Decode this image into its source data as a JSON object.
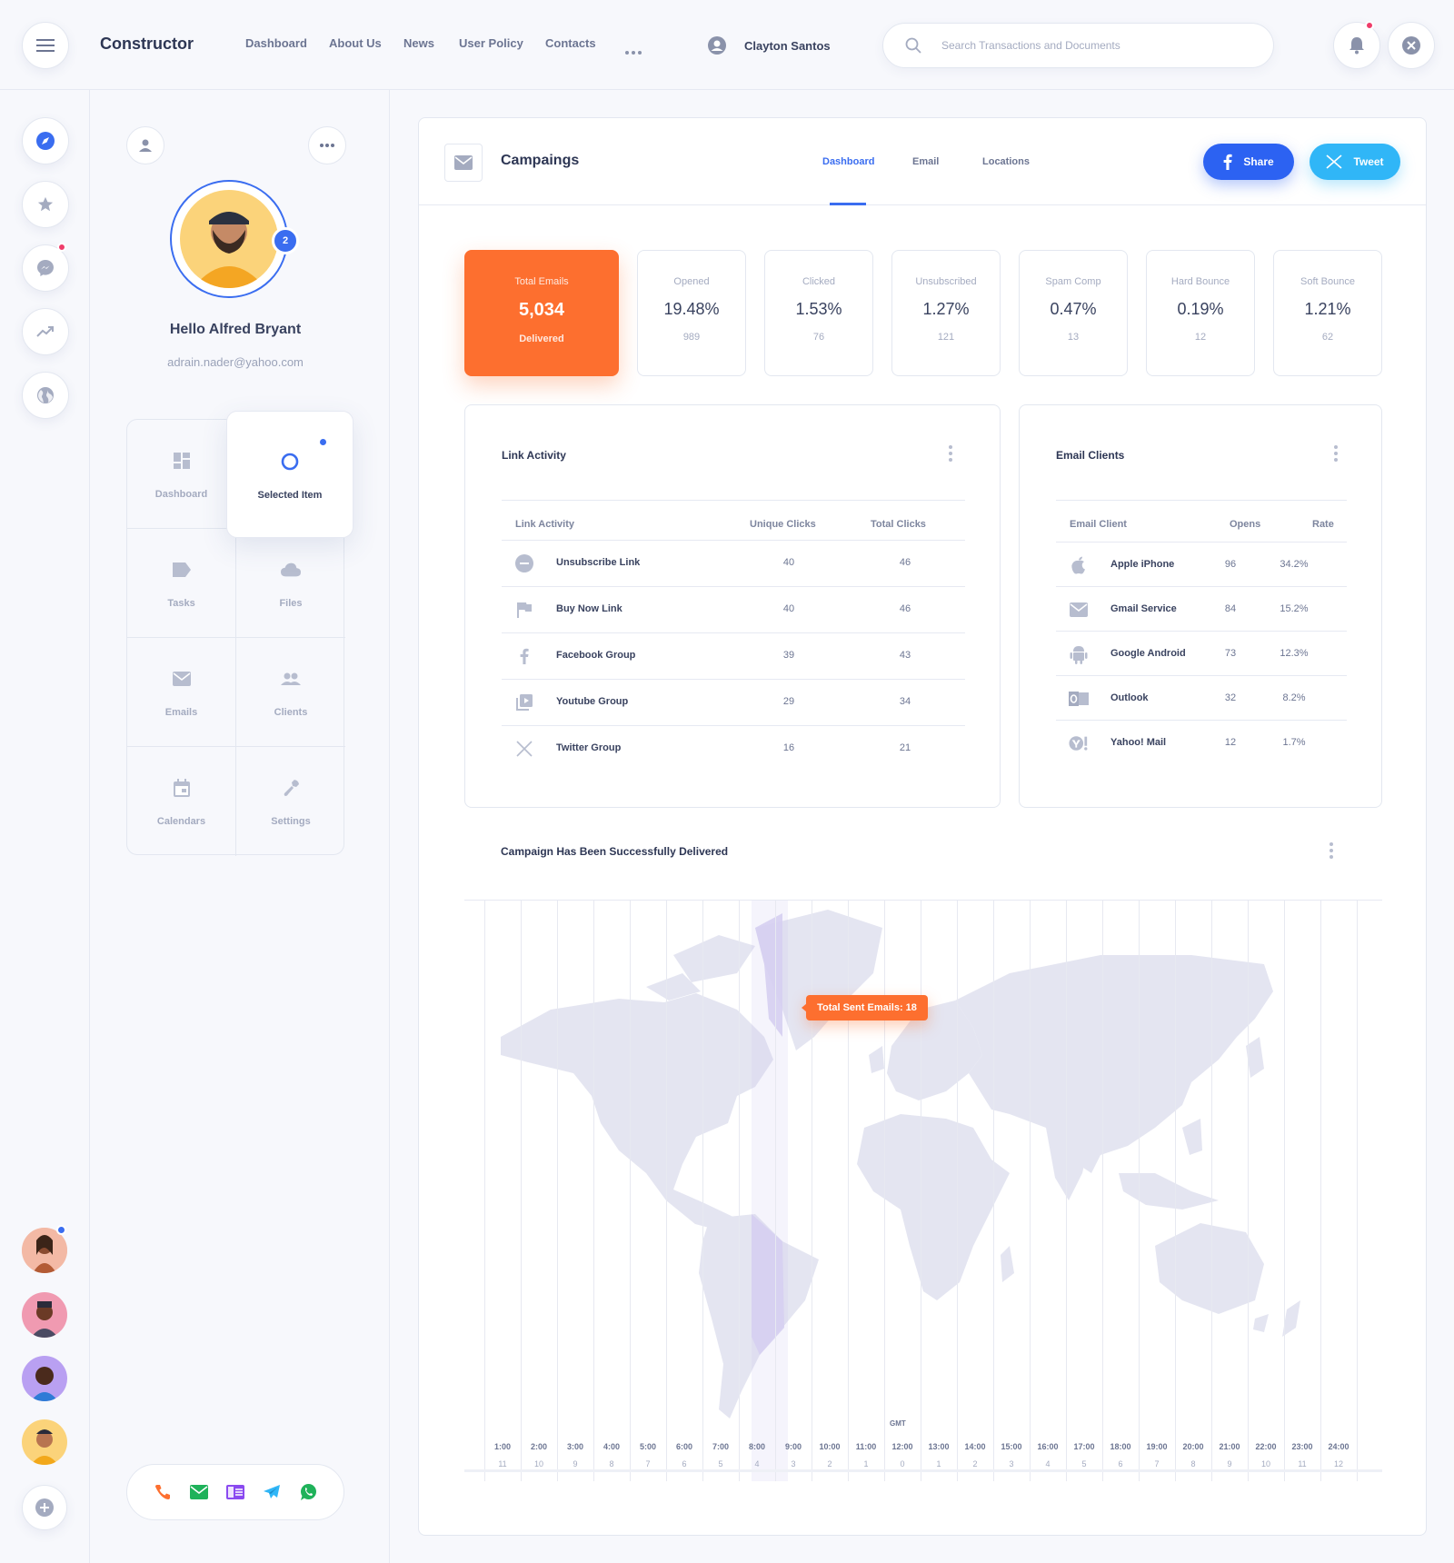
{
  "app": {
    "brand": "Constructor",
    "nav": [
      "Dashboard",
      "About Us",
      "News",
      "User Policy",
      "Contacts"
    ],
    "user_name": "Clayton Santos",
    "search_placeholder": "Search Transactions and Documents"
  },
  "profile": {
    "badge": "2",
    "greeting": "Hello Alfred Bryant",
    "email": "adrain.nader@yahoo.com",
    "menu": [
      {
        "label": "Dashboard",
        "icon": "dashboard-icon"
      },
      {
        "label": "Selected Item",
        "icon": "circle-icon"
      },
      {
        "label": "Tasks",
        "icon": "label-icon"
      },
      {
        "label": "Files",
        "icon": "cloud-icon"
      },
      {
        "label": "Emails",
        "icon": "mail-icon"
      },
      {
        "label": "Clients",
        "icon": "people-icon"
      },
      {
        "label": "Calendars",
        "icon": "calendar-icon"
      },
      {
        "label": "Settings",
        "icon": "wrench-icon"
      }
    ]
  },
  "campaign": {
    "title": "Campaings",
    "tabs": [
      "Dashboard",
      "Email",
      "Locations"
    ],
    "share_label": "Share",
    "tweet_label": "Tweet",
    "stats": [
      {
        "title": "Total Emails",
        "value": "5,034",
        "sub": "Delivered"
      },
      {
        "title": "Opened",
        "value": "19.48%",
        "sub": "989"
      },
      {
        "title": "Clicked",
        "value": "1.53%",
        "sub": "76"
      },
      {
        "title": "Unsubscribed",
        "value": "1.27%",
        "sub": "121"
      },
      {
        "title": "Spam Comp",
        "value": "0.47%",
        "sub": "13"
      },
      {
        "title": "Hard Bounce",
        "value": "0.19%",
        "sub": "12"
      },
      {
        "title": "Soft Bounce",
        "value": "1.21%",
        "sub": "62"
      }
    ]
  },
  "link_activity": {
    "title": "Link Activity",
    "headers": [
      "Link Activity",
      "Unique Clicks",
      "Total Clicks"
    ],
    "rows": [
      {
        "name": "Unsubscribe Link",
        "unique": "40",
        "total": "46",
        "icon": "minus-circle-icon"
      },
      {
        "name": "Buy Now Link",
        "unique": "40",
        "total": "46",
        "icon": "flag-icon"
      },
      {
        "name": "Facebook Group",
        "unique": "39",
        "total": "43",
        "icon": "facebook-icon"
      },
      {
        "name": "Youtube Group",
        "unique": "29",
        "total": "34",
        "icon": "video-library-icon"
      },
      {
        "name": "Twitter Group",
        "unique": "16",
        "total": "21",
        "icon": "x-twitter-icon"
      }
    ]
  },
  "email_clients": {
    "title": "Email Clients",
    "headers": [
      "Email Client",
      "Opens",
      "Rate"
    ],
    "rows": [
      {
        "name": "Apple iPhone",
        "opens": "96",
        "rate": "34.2%",
        "icon": "apple-icon"
      },
      {
        "name": "Gmail Service",
        "opens": "84",
        "rate": "15.2%",
        "icon": "mail-icon"
      },
      {
        "name": "Google Android",
        "opens": "73",
        "rate": "12.3%",
        "icon": "android-icon"
      },
      {
        "name": "Outlook",
        "opens": "32",
        "rate": "8.2%",
        "icon": "outlook-icon"
      },
      {
        "name": "Yahoo! Mail",
        "opens": "12",
        "rate": "1.7%",
        "icon": "yahoo-icon"
      }
    ]
  },
  "map": {
    "title": "Campaign Has Been Successfully Delivered",
    "tooltip": "Total Sent Emails: 18",
    "gmt_label": "GMT",
    "zones": [
      {
        "time": "1:00",
        "offset": "11"
      },
      {
        "time": "2:00",
        "offset": "10"
      },
      {
        "time": "3:00",
        "offset": "9"
      },
      {
        "time": "4:00",
        "offset": "8"
      },
      {
        "time": "5:00",
        "offset": "7"
      },
      {
        "time": "6:00",
        "offset": "6"
      },
      {
        "time": "7:00",
        "offset": "5"
      },
      {
        "time": "8:00",
        "offset": "4"
      },
      {
        "time": "9:00",
        "offset": "3"
      },
      {
        "time": "10:00",
        "offset": "2"
      },
      {
        "time": "11:00",
        "offset": "1"
      },
      {
        "time": "12:00",
        "offset": "0"
      },
      {
        "time": "13:00",
        "offset": "1"
      },
      {
        "time": "14:00",
        "offset": "2"
      },
      {
        "time": "15:00",
        "offset": "3"
      },
      {
        "time": "16:00",
        "offset": "4"
      },
      {
        "time": "17:00",
        "offset": "5"
      },
      {
        "time": "18:00",
        "offset": "6"
      },
      {
        "time": "19:00",
        "offset": "7"
      },
      {
        "time": "20:00",
        "offset": "8"
      },
      {
        "time": "21:00",
        "offset": "9"
      },
      {
        "time": "22:00",
        "offset": "10"
      },
      {
        "time": "23:00",
        "offset": "11"
      },
      {
        "time": "24:00",
        "offset": "12"
      }
    ]
  },
  "colors": {
    "accent": "#3a6df0",
    "orange": "#fd6f2f",
    "facebook": "#2c62f2",
    "twitter": "#30b6f7",
    "alert": "#ef3c6a"
  }
}
